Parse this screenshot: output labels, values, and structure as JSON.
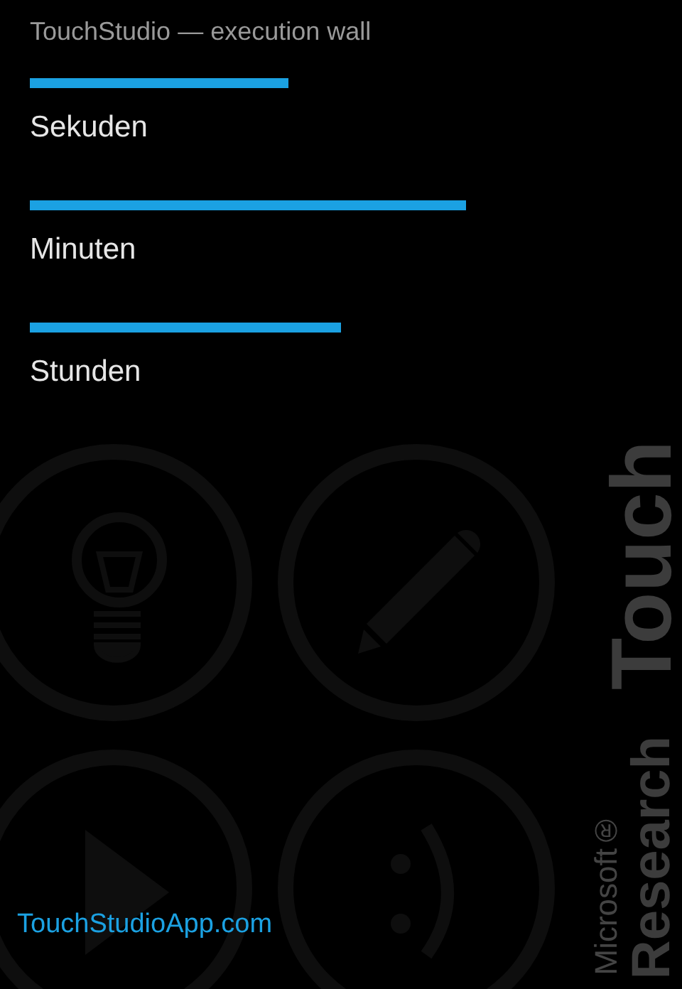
{
  "subtitle": "TouchStudio — execution wall",
  "meters": [
    {
      "label": "Sekuden",
      "level": 0.415
    },
    {
      "label": "Minuten",
      "level": 0.7
    },
    {
      "label": "Stunden",
      "level": 0.5
    }
  ],
  "background_brand": {
    "product": "Touch",
    "company": "Microsoft®",
    "division": "Research"
  },
  "link": "TouchStudioApp.com"
}
